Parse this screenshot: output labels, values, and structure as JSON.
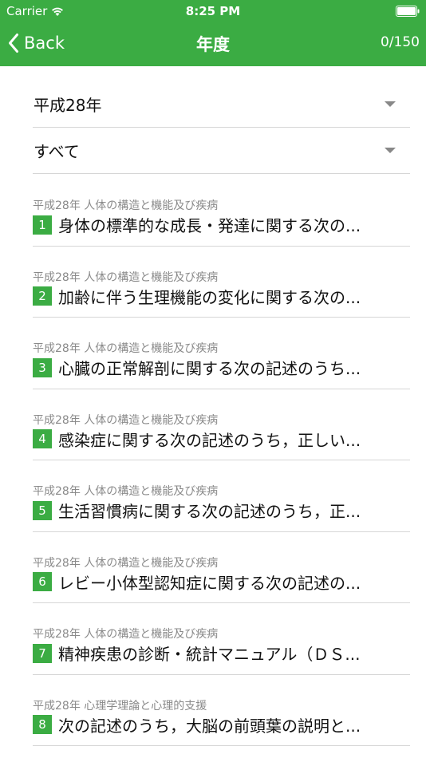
{
  "status_bar": {
    "carrier": "Carrier",
    "time": "8:25 PM",
    "wifi_icon": "wifi-icon",
    "battery_icon": "battery-icon"
  },
  "nav": {
    "back_label": "Back",
    "title": "年度",
    "count": "0/150",
    "back_icon": "chevron-left-icon",
    "accent_color": "#3bac43"
  },
  "filters": {
    "year": "平成28年",
    "category": "すべて",
    "dropdown_icon": "dropdown-triangle-icon"
  },
  "items": [
    {
      "meta": "平成28年 人体の構造と機能及び疾病",
      "number": "1",
      "title": "身体の標準的な成長・発達に関する次の..."
    },
    {
      "meta": "平成28年 人体の構造と機能及び疾病",
      "number": "2",
      "title": "加齢に伴う生理機能の変化に関する次の..."
    },
    {
      "meta": "平成28年 人体の構造と機能及び疾病",
      "number": "3",
      "title": "心臓の正常解剖に関する次の記述のうち..."
    },
    {
      "meta": "平成28年 人体の構造と機能及び疾病",
      "number": "4",
      "title": "感染症に関する次の記述のうち，正しい..."
    },
    {
      "meta": "平成28年 人体の構造と機能及び疾病",
      "number": "5",
      "title": "生活習慣病に関する次の記述のうち，正..."
    },
    {
      "meta": "平成28年 人体の構造と機能及び疾病",
      "number": "6",
      "title": "レビー小体型認知症に関する次の記述の..."
    },
    {
      "meta": "平成28年 人体の構造と機能及び疾病",
      "number": "7",
      "title": "精神疾患の診断・統計マニュアル（ＤＳ..."
    },
    {
      "meta": "平成28年 心理学理論と心理的支援",
      "number": "8",
      "title": "次の記述のうち，大脳の前頭葉の説明と..."
    }
  ]
}
